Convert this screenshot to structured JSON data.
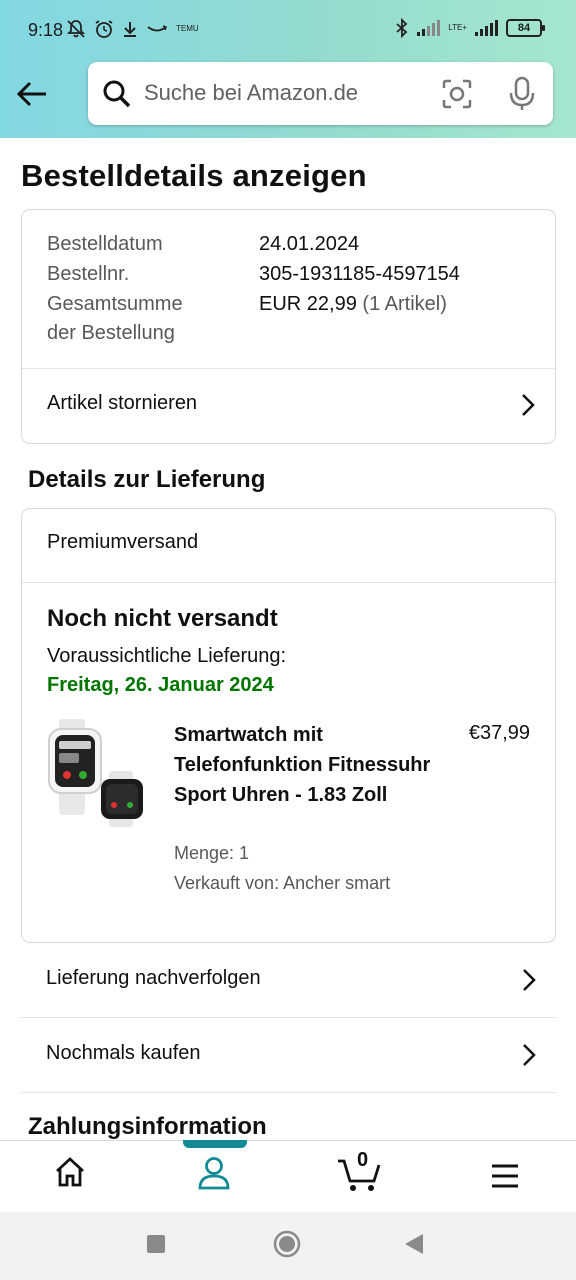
{
  "status_bar": {
    "time": "9:18",
    "network": "LTE+",
    "battery": "84",
    "temu_label": "TEMU"
  },
  "search": {
    "placeholder": "Suche bei Amazon.de"
  },
  "page_title": "Bestelldetails anzeigen",
  "order_summary": {
    "date_label": "Bestelldatum",
    "date_value": "24.01.2024",
    "number_label": "Bestellnr.",
    "number_value": "305-1931185-4597154",
    "total_label_1": "Gesamtsumme",
    "total_label_2": "der Bestellung",
    "total_value": "EUR 22,99",
    "total_items": "(1 Artikel)",
    "cancel_label": "Artikel stornieren"
  },
  "delivery": {
    "heading": "Details zur Lieferung",
    "shipping_type": "Premiumversand",
    "status": "Noch nicht versandt",
    "expected_label": "Voraussichtliche Lieferung:",
    "expected_date": "Freitag, 26. Januar 2024",
    "product": {
      "title": "Smartwatch mit Telefonfunktion Fitnessuhr Sport Uhren - 1.83 Zoll",
      "price": "€37,99",
      "quantity": "Menge: 1",
      "seller": "Verkauft von: Ancher smart"
    }
  },
  "actions": {
    "track": "Lieferung nachverfolgen",
    "buy_again": "Nochmals kaufen"
  },
  "payment_heading": "Zahlungsinformation",
  "bottom_nav": {
    "cart_count": "0",
    "active_tab": "account"
  },
  "colors": {
    "header_gradient_start": "#82d8e3",
    "header_gradient_end": "#a6e6cf",
    "delivery_date_green": "#007600",
    "active_tab_teal": "#108a95"
  }
}
